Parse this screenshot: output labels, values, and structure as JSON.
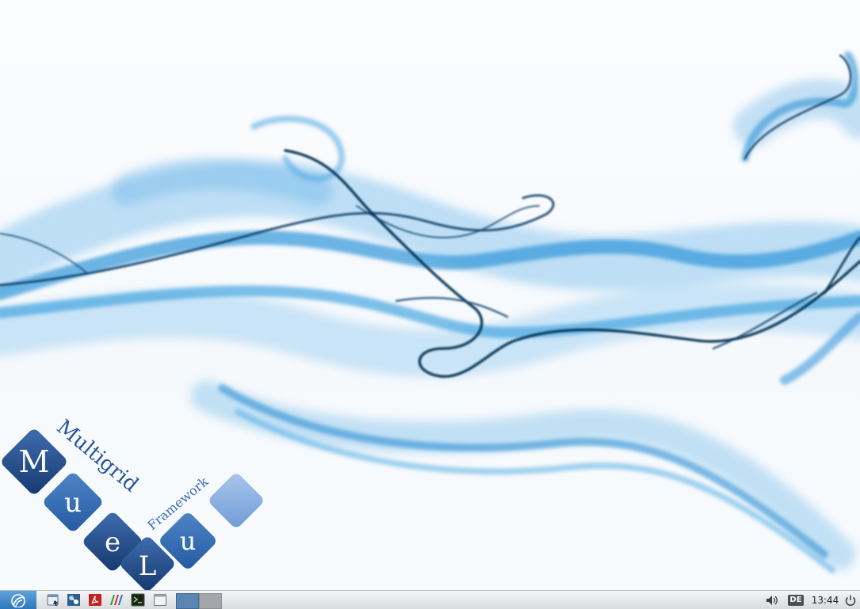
{
  "desktop": {
    "wallpaper_name": "blue-smoke",
    "logo": {
      "tiles": [
        "M",
        "u",
        "e",
        "L",
        "u"
      ],
      "title": "Multigrid",
      "subtitle": "Framework",
      "colors": {
        "dark": "#1d4e8c",
        "mid": "#2e6cb5",
        "light": "#7aa6dc"
      }
    }
  },
  "taskbar": {
    "start_icon": "start-menu-icon",
    "launchers": [
      {
        "name": "file-manager-icon"
      },
      {
        "name": "network-icon"
      },
      {
        "name": "pdf-reader-icon"
      },
      {
        "name": "paraview-icon"
      },
      {
        "name": "terminal-icon"
      },
      {
        "name": "window-icon"
      }
    ],
    "workspaces": [
      {
        "label": "",
        "active": true
      },
      {
        "label": "",
        "active": false
      }
    ],
    "tray": {
      "volume_icon": "volume-icon",
      "keyboard_layout": "DE",
      "clock": "13:44",
      "power_icon": "power-icon"
    },
    "accent": "#3a7fc1"
  }
}
